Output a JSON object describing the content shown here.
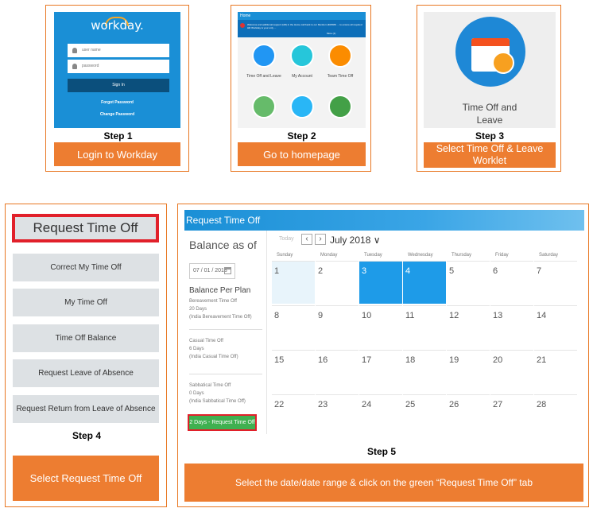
{
  "step1": {
    "logo": "workday.",
    "username_placeholder": "user name",
    "password_placeholder": "password",
    "signin": "Sign In",
    "forgot": "Forgot Password",
    "change": "Change Password",
    "label": "Step 1",
    "button": "Login to Workday",
    "brand_color": "#1a8fd6"
  },
  "step2": {
    "top_title": "Home",
    "banner_text": "Welcome and additional support (HR) in the Home call back to our Mention HR/RMS ... to ensure all required HR Workday is your only ...",
    "banner_more": "More (1)",
    "tiles": [
      {
        "label": "Time Off and Leave",
        "icon": "calendar-icon",
        "color": "#2196f3"
      },
      {
        "label": "My Account",
        "icon": "account-icon",
        "color": "#26c6da"
      },
      {
        "label": "Team Time Off",
        "icon": "team-calendar-icon",
        "color": "#fb8c00"
      },
      {
        "label": "",
        "icon": "benefits-icon",
        "color": "#66bb6a"
      },
      {
        "label": "",
        "icon": "heart-icon",
        "color": "#29b6f6"
      },
      {
        "label": "",
        "icon": "clock-icon",
        "color": "#43a047"
      }
    ],
    "label": "Step 2",
    "button": "Go to homepage"
  },
  "step3": {
    "worklet_text_line1": "Time Off and",
    "worklet_text_line2": "Leave",
    "label": "Step 3",
    "button": "Select Time Off & Leave Worklet"
  },
  "step4": {
    "title": "Request Time Off",
    "items": [
      "Correct My Time Off",
      "My Time Off",
      "Time Off Balance",
      "Request Leave of Absence",
      "Request Return from Leave of Absence"
    ],
    "label": "Step 4",
    "button": "Select Request Time Off"
  },
  "step5": {
    "header": "Request Time Off",
    "balance_title": "Balance as of",
    "date_value": "07 / 01 / 2018",
    "plan_title": "Balance Per Plan",
    "plans": [
      {
        "name": "Bereavement Time Off",
        "days": "20 Days",
        "sub": "(India Bereavement Time Off)"
      },
      {
        "name": "Casual Time Off",
        "days": "6 Days",
        "sub": "(India Casual Time Off)"
      },
      {
        "name": "Sabbatical Time Off",
        "days": "0 Days",
        "sub": "(India Sabbatical Time Off)"
      }
    ],
    "request_button": "2 Days - Request Time Off",
    "today": "Today",
    "prev": "‹",
    "next": "›",
    "month": "July 2018 ∨",
    "weekdays": [
      "Sunday",
      "Monday",
      "Tuesday",
      "Wednesday",
      "Thursday",
      "Friday",
      "Saturday"
    ],
    "weeks": [
      [
        "1",
        "2",
        "3",
        "4",
        "5",
        "6",
        "7"
      ],
      [
        "8",
        "9",
        "10",
        "11",
        "12",
        "13",
        "14"
      ],
      [
        "15",
        "16",
        "17",
        "18",
        "19",
        "20",
        "21"
      ],
      [
        "22",
        "23",
        "24",
        "25",
        "26",
        "27",
        "28"
      ]
    ],
    "selected_days": [
      "3",
      "4"
    ],
    "today_day": "1",
    "label": "Step 5",
    "instruction": "Select the date/date range & click on the green “Request Time Off” tab"
  },
  "colors": {
    "accent": "#ed7d31",
    "selected": "#1e9be8",
    "request_green": "#3fb050",
    "highlight_red": "#e1202a"
  }
}
